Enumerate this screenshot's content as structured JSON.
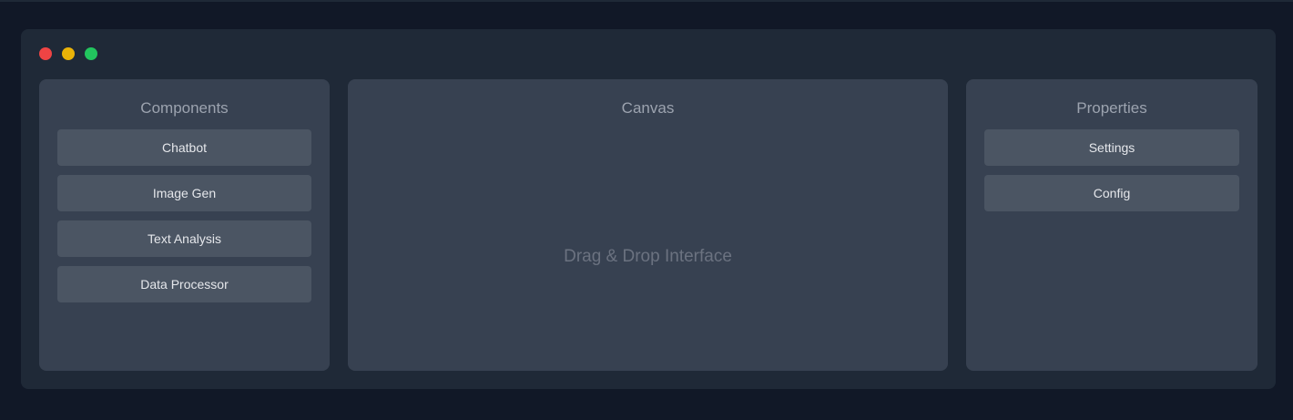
{
  "window": {
    "controls": {
      "close": {
        "icon": "close-dot",
        "color": "#ef4444"
      },
      "minimize": {
        "icon": "minimize-dot",
        "color": "#eab308"
      },
      "maximize": {
        "icon": "maximize-dot",
        "color": "#22c55e"
      }
    }
  },
  "components": {
    "title": "Components",
    "items": [
      {
        "label": "Chatbot"
      },
      {
        "label": "Image Gen"
      },
      {
        "label": "Text Analysis"
      },
      {
        "label": "Data Processor"
      }
    ]
  },
  "canvas": {
    "title": "Canvas",
    "hint": "Drag & Drop Interface"
  },
  "properties": {
    "title": "Properties",
    "items": [
      {
        "label": "Settings"
      },
      {
        "label": "Config"
      }
    ]
  },
  "colors": {
    "background": "#111827",
    "window": "#1f2937",
    "panel": "#374151",
    "button": "#4b5563"
  }
}
